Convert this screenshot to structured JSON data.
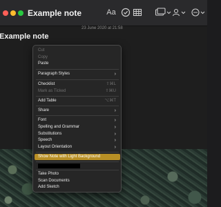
{
  "window": {
    "title": "Example note"
  },
  "toolbar": {
    "icons": [
      "format-text-icon",
      "checklist-icon",
      "table-icon",
      "attachments-icon",
      "collaborate-icon",
      "more-icon"
    ],
    "format_label": "Aa"
  },
  "note": {
    "date": "23 June 2020 at 21:58",
    "title": "Example note"
  },
  "context_menu": {
    "cut": "Cut",
    "copy": "Copy",
    "paste": "Paste",
    "paragraph_styles": "Paragraph Styles",
    "checklist": "Checklist",
    "checklist_shortcut": "⇧⌘L",
    "mark_as_ticked": "Mark as Ticked",
    "mark_as_ticked_shortcut": "⇧⌘U",
    "add_table": "Add Table",
    "add_table_shortcut": "⌥⌘T",
    "share": "Share",
    "font": "Font",
    "spelling_and_grammar": "Spelling and Grammar",
    "substitutions": "Substitutions",
    "speech": "Speech",
    "layout_orientation": "Layout Orientation",
    "show_note_light": "Show Note with Light Background",
    "take_photo": "Take Photo",
    "scan_documents": "Scan Documents",
    "add_sketch": "Add Sketch",
    "submenu_indicator": "›"
  },
  "colors": {
    "highlight": "#b88f25",
    "close": "#ff5f57",
    "minimize": "#febc2e",
    "zoom": "#28c840"
  }
}
